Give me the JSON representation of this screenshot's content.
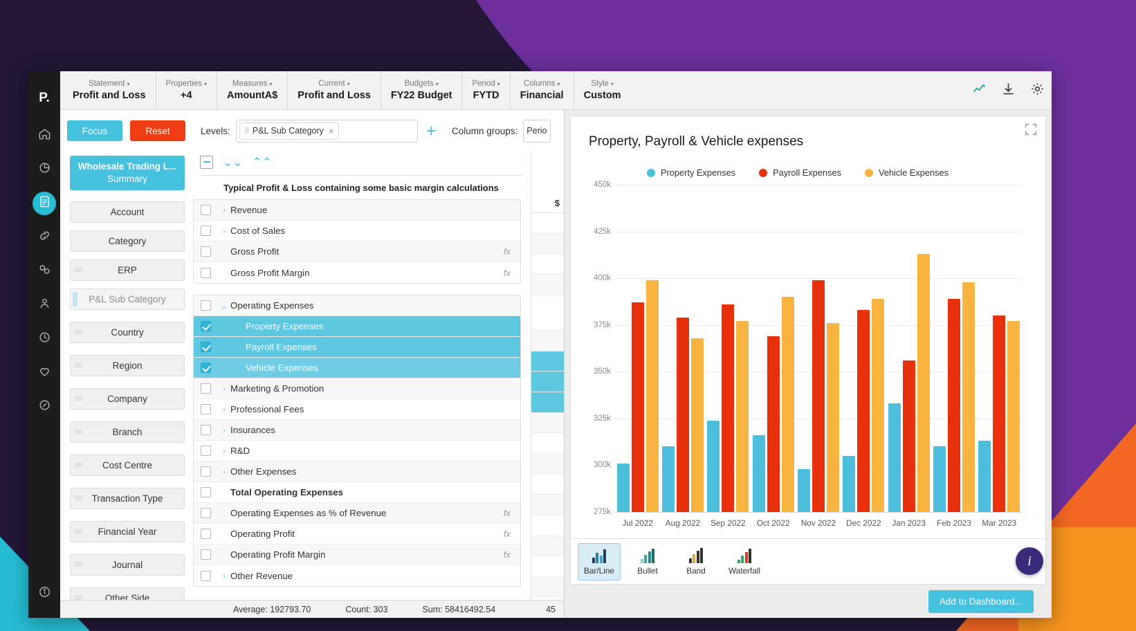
{
  "app": {
    "logo": "P.",
    "window_title": "Profit and Loss"
  },
  "rail": {
    "items": [
      {
        "name": "home",
        "icon": "home-icon"
      },
      {
        "name": "analytics",
        "icon": "pie-chart-icon"
      },
      {
        "name": "reports",
        "icon": "report-icon",
        "active": true
      },
      {
        "name": "link",
        "icon": "link-icon"
      },
      {
        "name": "tag",
        "icon": "tag-icon"
      },
      {
        "name": "users",
        "icon": "user-icon"
      },
      {
        "name": "history",
        "icon": "clock-icon"
      },
      {
        "name": "favourites",
        "icon": "heart-icon"
      },
      {
        "name": "performance",
        "icon": "gauge-icon"
      }
    ],
    "bottom": {
      "name": "info",
      "icon": "info-icon"
    }
  },
  "menubar": {
    "groups": [
      {
        "label": "Statement",
        "value": "Profit and Loss"
      },
      {
        "label": "Properties",
        "value": "+4"
      },
      {
        "label": "Measures",
        "value": "AmountA$"
      },
      {
        "label": "Current",
        "value": "Profit and Loss"
      },
      {
        "label": "Budgets",
        "value": "FY22 Budget"
      },
      {
        "label": "Period",
        "value": "FYTD"
      },
      {
        "label": "Columns",
        "value": "Financial"
      },
      {
        "label": "Style",
        "value": "Custom"
      }
    ],
    "caret": "▾",
    "icons": [
      {
        "name": "chart-icon",
        "color": "#1fae8f"
      },
      {
        "name": "download-icon",
        "color": "#3d3d3d"
      },
      {
        "name": "gear-icon",
        "color": "#3d3d3d"
      }
    ]
  },
  "toolbar": {
    "focus_label": "Focus",
    "reset_label": "Reset",
    "levels_label": "Levels:",
    "level_chip": "P&L Sub Category",
    "chip_close": "×",
    "add_level": "+",
    "column_groups_label": "Column groups:",
    "column_group_value": "Perio"
  },
  "dimensions": {
    "summary_line1": "Wholesale Trading L...",
    "summary_line2": "Summary",
    "items": [
      {
        "label": "Account",
        "grip": false,
        "gap": false
      },
      {
        "label": "Category",
        "grip": false,
        "gap": false
      },
      {
        "label": "ERP",
        "grip": true,
        "gap": false
      },
      {
        "label": "P&L Sub Category",
        "grip": false,
        "gap": true,
        "selected": true
      },
      {
        "label": "Country",
        "grip": true,
        "gap": true
      },
      {
        "label": "Region",
        "grip": true,
        "gap": true
      },
      {
        "label": "Company",
        "grip": true,
        "gap": true
      },
      {
        "label": "Branch",
        "grip": true,
        "gap": true
      },
      {
        "label": "Cost Centre",
        "grip": true,
        "gap": true
      },
      {
        "label": "Transaction Type",
        "grip": true,
        "gap": true
      },
      {
        "label": "Financial Year",
        "grip": true,
        "gap": true
      },
      {
        "label": "Journal",
        "grip": true,
        "gap": true
      },
      {
        "label": "Other Side",
        "grip": true,
        "gap": true
      }
    ]
  },
  "tree": {
    "caption": "Typical Profit & Loss containing some basic margin calculations",
    "collapse_all_icon": "collapse-icon",
    "expand_down_icon": "chevron-double-down-icon",
    "collapse_up_icon": "chevron-double-up-icon",
    "block1": [
      {
        "label": "Revenue",
        "arrow": "›",
        "fx": "",
        "bold": false,
        "selected": false,
        "indent": false
      },
      {
        "label": "Cost of Sales",
        "arrow": "›",
        "fx": "",
        "bold": false,
        "selected": false,
        "indent": false
      },
      {
        "label": "Gross Profit",
        "arrow": "",
        "fx": "fx",
        "bold": false,
        "selected": false,
        "indent": false
      },
      {
        "label": "Gross Profit Margin",
        "arrow": "",
        "fx": "fx",
        "bold": false,
        "selected": false,
        "indent": false
      }
    ],
    "block2": [
      {
        "label": "Operating Expenses",
        "arrow": "⌄",
        "fx": "",
        "bold": false,
        "selected": false,
        "indent": false
      },
      {
        "label": "Property Expenses",
        "arrow": "",
        "fx": "",
        "bold": false,
        "selected": true,
        "indent": true
      },
      {
        "label": "Payroll Expenses",
        "arrow": "",
        "fx": "",
        "bold": false,
        "selected": true,
        "indent": true
      },
      {
        "label": "Vehicle Expenses",
        "arrow": "",
        "fx": "",
        "bold": false,
        "selected": true,
        "indent": true
      },
      {
        "label": "Marketing & Promotion",
        "arrow": "›",
        "fx": "",
        "bold": false,
        "selected": false,
        "indent": true
      },
      {
        "label": "Professional Fees",
        "arrow": "›",
        "fx": "",
        "bold": false,
        "selected": false,
        "indent": true
      },
      {
        "label": "Insurances",
        "arrow": "›",
        "fx": "",
        "bold": false,
        "selected": false,
        "indent": true
      },
      {
        "label": "R&D",
        "arrow": "›",
        "fx": "",
        "bold": false,
        "selected": false,
        "indent": true
      },
      {
        "label": "Other Expenses",
        "arrow": "›",
        "fx": "",
        "bold": false,
        "selected": false,
        "indent": true
      },
      {
        "label": "Total Operating Expenses",
        "arrow": "",
        "fx": "",
        "bold": true,
        "selected": false,
        "indent": false
      },
      {
        "label": "Operating Expenses as % of Revenue",
        "arrow": "",
        "fx": "fx",
        "bold": false,
        "selected": false,
        "indent": false
      },
      {
        "label": "Operating Profit",
        "arrow": "",
        "fx": "fx",
        "bold": false,
        "selected": false,
        "indent": false
      },
      {
        "label": "Operating Profit Margin",
        "arrow": "",
        "fx": "fx",
        "bold": false,
        "selected": false,
        "indent": false
      },
      {
        "label": "Other Revenue",
        "arrow": "›",
        "fx": "",
        "bold": false,
        "selected": false,
        "indent": false
      }
    ],
    "currency_symbol": "$"
  },
  "statusbar": {
    "average": "Average: 192793.70",
    "count": "Count: 303",
    "sum": "Sum: 58416492.54",
    "right_value": "45"
  },
  "chart_panel": {
    "expand_icon": "expand-icon",
    "types": [
      {
        "label": "Bar/Line",
        "icon": "bar-line-chart-icon",
        "active": true
      },
      {
        "label": "Bullet",
        "icon": "bullet-chart-icon",
        "active": false
      },
      {
        "label": "Band",
        "icon": "band-chart-icon",
        "active": false
      },
      {
        "label": "Waterfall",
        "icon": "waterfall-chart-icon",
        "active": false
      }
    ],
    "add_to_dashboard": "Add to Dashboard...",
    "info_fab": "i"
  },
  "chart_data": {
    "type": "bar",
    "title": "Property, Payroll & Vehicle expenses",
    "xlabel": "",
    "ylabel": "",
    "ylim": [
      275000,
      450000
    ],
    "ytick_labels": [
      "450k",
      "425k",
      "400k",
      "375k",
      "350k",
      "325k",
      "300k"
    ],
    "ytick_values": [
      450000,
      425000,
      400000,
      375000,
      350000,
      325000,
      300000
    ],
    "grid": true,
    "legend_position": "top-center",
    "categories": [
      "Jul 2022",
      "Aug 2022",
      "Sep 2022",
      "Oct 2022",
      "Nov 2022",
      "Dec 2022",
      "Jan 2023",
      "Feb 2023",
      "Mar 2023"
    ],
    "series": [
      {
        "name": "Property Expenses",
        "color": "#4bbfdc",
        "values": [
          301000,
          310000,
          324000,
          316000,
          298000,
          305000,
          333000,
          310000,
          313000
        ]
      },
      {
        "name": "Payroll Expenses",
        "color": "#e8300c",
        "values": [
          387000,
          379000,
          386000,
          369000,
          399000,
          383000,
          356000,
          389000,
          380000
        ]
      },
      {
        "name": "Vehicle Expenses",
        "color": "#f9b340",
        "values": [
          399000,
          368000,
          377000,
          390000,
          376000,
          389000,
          413000,
          398000,
          377000
        ]
      }
    ]
  }
}
